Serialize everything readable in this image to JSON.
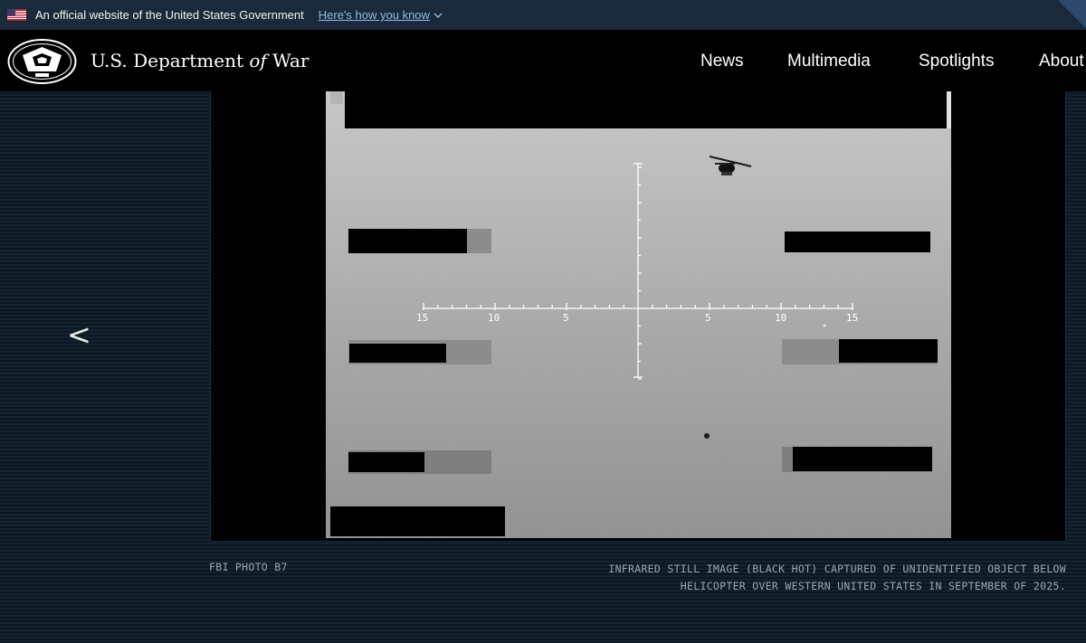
{
  "gov_banner": {
    "text": "An official website of the United States Government",
    "link": "Here's how you know"
  },
  "header": {
    "title_prefix": "U.S. Department",
    "title_of": "of",
    "title_suffix": "War",
    "nav": [
      "News",
      "Multimedia",
      "Spotlights",
      "About"
    ]
  },
  "gallery": {
    "prev_label": "<",
    "credit": "FBI PHOTO B7",
    "caption": "INFRARED STILL IMAGE (BLACK HOT) CAPTURED OF UNIDENTIFIED OBJECT BELOW HELICOPTER OVER WESTERN UNITED STATES IN SEPTEMBER OF 2025."
  },
  "reticle": {
    "scale_labels": [
      "15",
      "10",
      "5",
      "5",
      "10",
      "15"
    ]
  },
  "colors": {
    "banner_bg": "#1b2a3a",
    "link": "#8fb8e6",
    "header_bg": "#000000",
    "caption": "#9aa7b2"
  }
}
